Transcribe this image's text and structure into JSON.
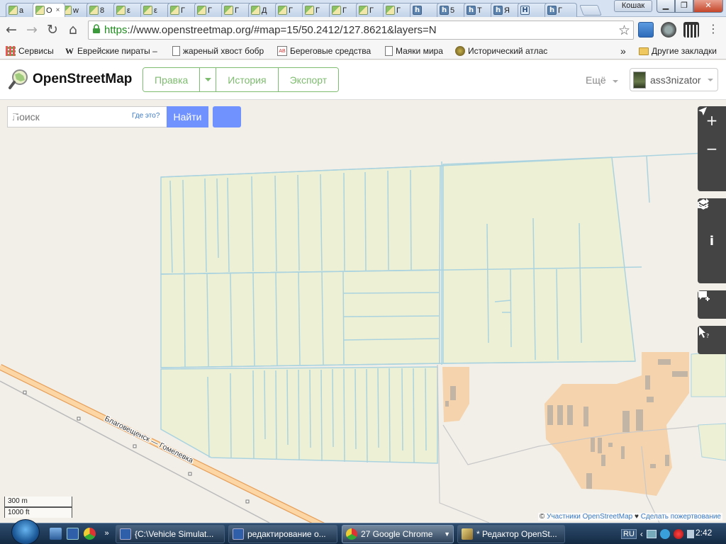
{
  "browser": {
    "tabs": [
      {
        "label": "а",
        "favicon": "osm-favicon"
      },
      {
        "label": "О",
        "favicon": "osm-favicon",
        "active": true,
        "close": "×"
      },
      {
        "label": "w",
        "favicon": "osm-favicon"
      },
      {
        "label": "8",
        "favicon": "osm-favicon"
      },
      {
        "label": "ε",
        "favicon": "osm-favicon"
      },
      {
        "label": "ε",
        "favicon": "osm-favicon"
      },
      {
        "label": "Г",
        "favicon": "osm-favicon"
      },
      {
        "label": "Г",
        "favicon": "osm-favicon"
      },
      {
        "label": "Г",
        "favicon": "osm-favicon"
      },
      {
        "label": "Д",
        "favicon": "osm-favicon"
      },
      {
        "label": "Г",
        "favicon": "osm-favicon"
      },
      {
        "label": "Г",
        "favicon": "osm-favicon"
      },
      {
        "label": "Г",
        "favicon": "osm-favicon"
      },
      {
        "label": "Г",
        "favicon": "osm-favicon"
      },
      {
        "label": "Г",
        "favicon": "osm-favicon"
      },
      {
        "label": "",
        "favicon": "h-favicon",
        "glyph": "h"
      },
      {
        "label": "5",
        "favicon": "h-favicon",
        "glyph": "h"
      },
      {
        "label": "Т",
        "favicon": "h-favicon",
        "glyph": "h"
      },
      {
        "label": "Я",
        "favicon": "h-favicon",
        "glyph": "h"
      },
      {
        "label": "",
        "favicon": "h-white-favicon",
        "glyph": "H"
      },
      {
        "label": "Г",
        "favicon": "h-favicon",
        "glyph": "h"
      }
    ],
    "profile_name": "Кошак",
    "window_controls": {
      "minimize": "▁",
      "maximize": "❐",
      "close": "✕"
    },
    "url_scheme": "https",
    "url_rest": "://www.openstreetmap.org/#map=15/50.2412/127.8621&layers=N",
    "nav_icons": {
      "back": "←",
      "forward": "→",
      "reload": "↻",
      "home": "⌂",
      "star": "☆",
      "lock": "🔒"
    },
    "bookmarks": [
      {
        "label": "Сервисы",
        "icon": "apps-grid-icon"
      },
      {
        "label": "Еврейские пираты –",
        "icon": "wikipedia-icon",
        "glyph": "W"
      },
      {
        "label": "жареный хвост бобр",
        "icon": "page-icon"
      },
      {
        "label": "Береговые средства",
        "icon": "ab-icon",
        "glyph": "AB"
      },
      {
        "label": "Маяки мира",
        "icon": "page-icon"
      },
      {
        "label": "Исторический атлас",
        "icon": "atlas-icon"
      }
    ],
    "bookmarks_overflow": "»",
    "other_bookmarks": "Другие закладки"
  },
  "osm": {
    "site_name": "OpenStreetMap",
    "edit_label": "Правка",
    "history_label": "История",
    "export_label": "Экспорт",
    "more_label": "Ещё",
    "username": "ass3nizator",
    "search_placeholder": "Поиск",
    "where_label": "Где это?",
    "search_button": "Найти",
    "controls": [
      "zoom-in-icon",
      "zoom-out-icon",
      "locate-icon",
      "layers-icon",
      "info-icon",
      "share-icon",
      "note-icon",
      "query-icon"
    ],
    "scale_metric": "300 m",
    "scale_imperial": "1000 ft",
    "attribution_prefix": "© ",
    "attribution_link1": "Участники OpenStreetMap",
    "attribution_heart": " ♥ ",
    "attribution_link2": "Сделать пожертвование",
    "road_label": "Благовещенск — Гомелевка"
  },
  "taskbar": {
    "tasks": [
      {
        "label": "{C:\\Vehicle Simulat...",
        "icon": "document-icon"
      },
      {
        "label": "редактирование о...",
        "icon": "document-icon"
      },
      {
        "label": "27 Google Chrome",
        "icon": "chrome-icon",
        "on": true
      },
      {
        "label": "* Редактор OpenSt...",
        "icon": "editor-icon"
      }
    ],
    "language": "RU",
    "clock": "2:42"
  },
  "colors": {
    "farmland": "#eef0d5",
    "ditch": "#aad3df",
    "residential": "#f5d3ad",
    "road": "#fcd6a4",
    "road_casing": "#e6a05b",
    "osm_green": "#7ebc6f",
    "search_blue": "#7092ff"
  }
}
